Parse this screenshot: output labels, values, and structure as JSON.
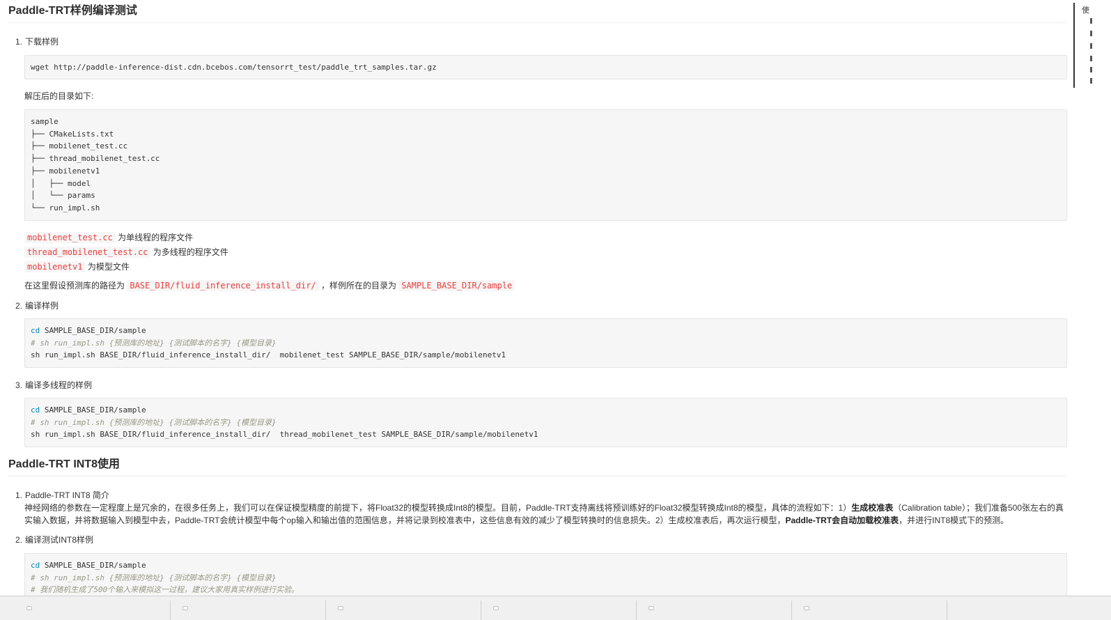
{
  "section1": {
    "title": "Paddle-TRT样例编译测试",
    "step1": {
      "num": "1.",
      "label": "下载样例",
      "cmd": "wget http://paddle-inference-dist.cdn.bcebos.com/tensorrt_test/paddle_trt_samples.tar.gz",
      "dir_intro": "解压后的目录如下:",
      "tree": [
        "sample",
        "├── CMakeLists.txt",
        "├── mobilenet_test.cc",
        "├── thread_mobilenet_test.cc",
        "├── mobilenetv1",
        "│   ├── model",
        "│   └── params",
        "└── run_impl.sh"
      ],
      "notes": [
        {
          "code": "mobilenet_test.cc",
          "text": " 为单线程的程序文件"
        },
        {
          "code": "thread_mobilenet_test.cc",
          "text": " 为多线程的程序文件"
        },
        {
          "code": "mobilenetv1",
          "text": " 为模型文件"
        }
      ],
      "path_text1": "在这里假设预测库的路径为 ",
      "path_code1": "BASE_DIR/fluid_inference_install_dir/",
      "path_text2": " ，样例所在的目录为 ",
      "path_code2": "SAMPLE_BASE_DIR/sample"
    },
    "step2": {
      "num": "2.",
      "label": "编译样例",
      "line1_kw": "cd",
      "line1_rest": " SAMPLE_BASE_DIR/sample",
      "line2": "# sh run_impl.sh {预测库的地址} {测试脚本的名字} {模型目录}",
      "line3": "sh run_impl.sh BASE_DIR/fluid_inference_install_dir/  mobilenet_test SAMPLE_BASE_DIR/sample/mobilenetv1"
    },
    "step3": {
      "num": "3.",
      "label": "编译多线程的样例",
      "line1_kw": "cd",
      "line1_rest": " SAMPLE_BASE_DIR/sample",
      "line2": "# sh run_impl.sh {预测库的地址} {测试脚本的名字} {模型目录}",
      "line3": "sh run_impl.sh BASE_DIR/fluid_inference_install_dir/  thread_mobilenet_test SAMPLE_BASE_DIR/sample/mobilenetv1"
    }
  },
  "section2": {
    "title": "Paddle-TRT INT8使用",
    "step1": {
      "num": "1.",
      "label": "Paddle-TRT INT8 简介",
      "p_a": "神经网络的参数在一定程度上是冗余的，在很多任务上，我们可以在保证模型精度的前提下，将Float32的模型转换成Int8的模型。目前，Paddle-TRT支持离线将预训练好的Float32模型转换成Int8的模型，具体的流程如下：1）",
      "p_b": "生成校准表",
      "p_c": "（Calibration table）；我们准备500张左右的真实输入数据，并将数据输入到模型中去，Paddle-TRT会统计模型中每个op输入和输出值的范围信息，并将记录到校准表中，这些信息有效的减少了模型转换时的信息损失。2）生成校准表后，再次运行模型，",
      "p_d": "Paddle-TRT会自动加载校准表",
      "p_e": "，并进行INT8模式下的预测。"
    },
    "step2": {
      "num": "2.",
      "label": "编译测试INT8样例",
      "line1_kw": "cd",
      "line1_rest": " SAMPLE_BASE_DIR/sample",
      "line2": "# sh run_impl.sh {预测库的地址} {测试脚本的名字} {模型目录}",
      "line3": "# 我们随机生成了500个输入来模拟这一过程，建议大家用真实样例进行实验。"
    }
  },
  "side_panel": {
    "label": "使"
  }
}
